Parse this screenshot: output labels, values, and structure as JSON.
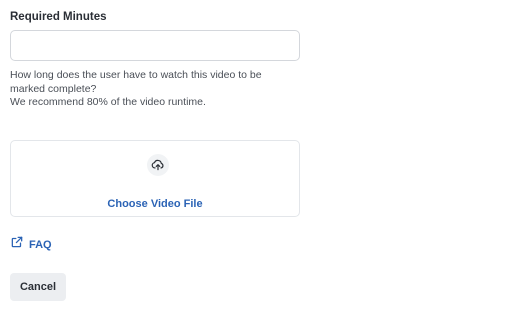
{
  "form": {
    "minutes_label": "Required Minutes",
    "minutes_value": "",
    "minutes_placeholder": "",
    "help_line1": "How long does the user have to watch this video to be",
    "help_line2": "marked complete?",
    "help_line3": "We recommend 80% of the video runtime."
  },
  "upload": {
    "icon": "cloud-upload-icon",
    "label": "Choose Video File"
  },
  "faq": {
    "icon": "external-link-icon",
    "label": "FAQ"
  },
  "actions": {
    "cancel_label": "Cancel"
  },
  "colors": {
    "link": "#2b63b5",
    "border": "#d4d7dc",
    "button_bg": "#eceef1",
    "text": "#2b2f36"
  }
}
